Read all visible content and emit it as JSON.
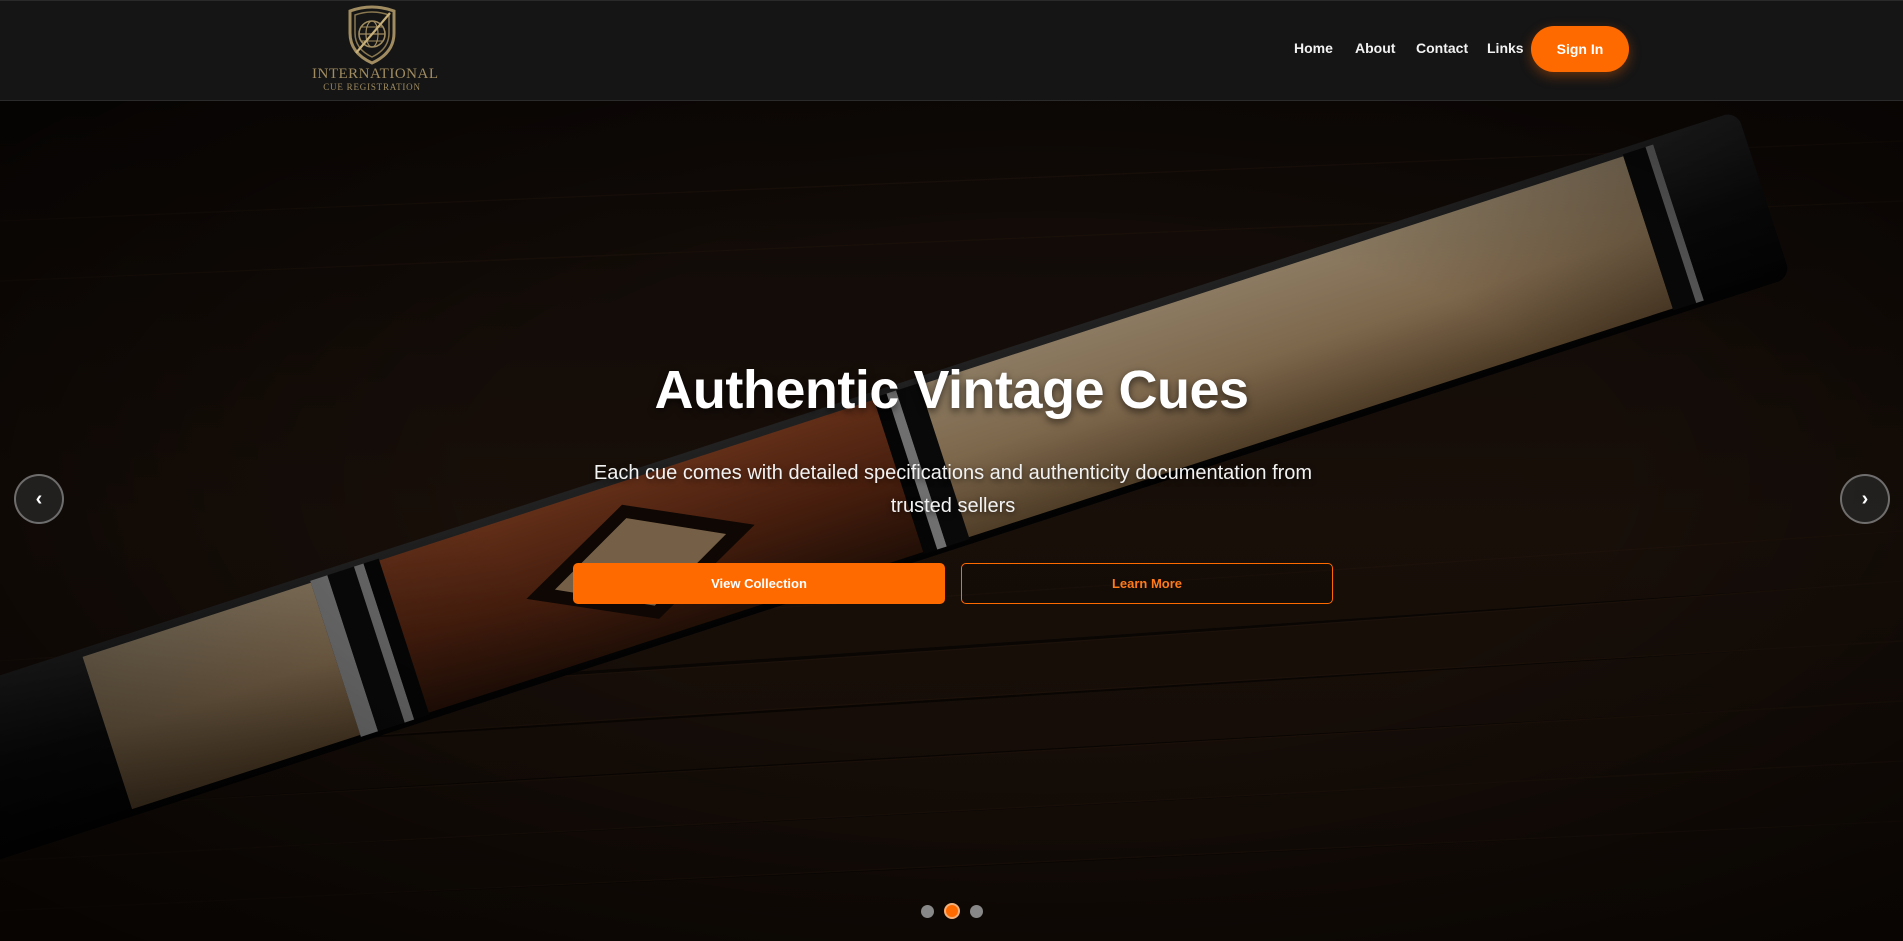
{
  "brand": {
    "line1": "INTERNATIONAL",
    "line2": "CUE REGISTRATION",
    "icon": "shield-globe-logo"
  },
  "nav": {
    "items": [
      {
        "label": "Home"
      },
      {
        "label": "About"
      },
      {
        "label": "Contact"
      },
      {
        "label": "Links"
      }
    ],
    "signin_label": "Sign In"
  },
  "hero": {
    "title": "Authentic Vintage Cues",
    "subtitle": "Each cue comes with detailed specifications and authenticity documentation from trusted sellers",
    "primary_button": "View Collection",
    "secondary_button": "Learn More",
    "prev_label": "‹",
    "next_label": "›",
    "slides_total": 3,
    "active_slide": 2
  },
  "colors": {
    "accent": "#ff6a00",
    "header_bg": "#151515",
    "logo_gold": "#a08c60"
  }
}
